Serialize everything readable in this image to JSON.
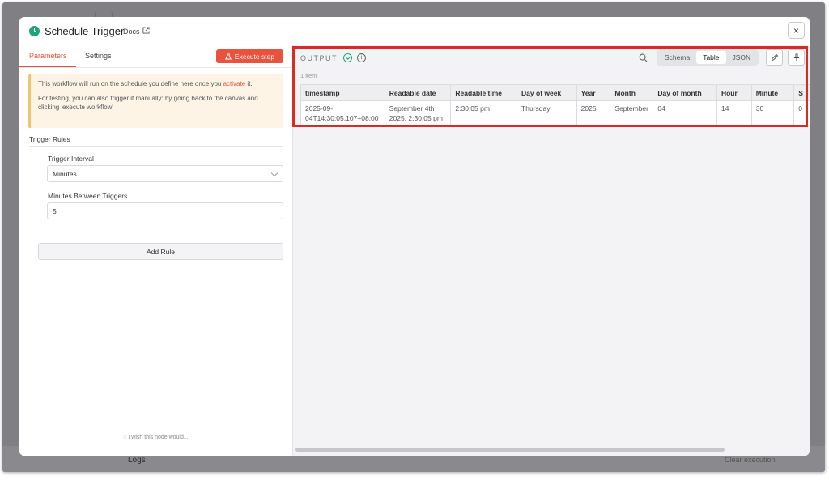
{
  "background": {
    "logs_label": "Logs",
    "clear_execution_label": "Clear execution"
  },
  "modal": {
    "title": "Schedule Trigger",
    "docs_label": "Docs",
    "close_icon": "×"
  },
  "left": {
    "tabs": [
      {
        "label": "Parameters",
        "active": true
      },
      {
        "label": "Settings",
        "active": false
      }
    ],
    "execute_button_label": "Execute step",
    "notice": {
      "line1_before": "This workflow will run on the schedule you define here once you ",
      "line1_link": "activate",
      "line1_after": " it.",
      "line2": "For testing, you can also trigger it manually: by going back to the canvas and clicking 'execute workflow'"
    },
    "section_title": "Trigger Rules",
    "trigger_interval": {
      "label": "Trigger Interval",
      "value": "Minutes"
    },
    "minutes_between": {
      "label": "Minutes Between Triggers",
      "value": "5"
    },
    "add_rule_label": "Add Rule",
    "footer_hint": "I wish this node would..."
  },
  "output": {
    "label": "OUTPUT",
    "info_icon": "i",
    "views": [
      "Schema",
      "Table",
      "JSON"
    ],
    "active_view": "Table",
    "items_count": "1 item",
    "columns": [
      "timestamp",
      "Readable date",
      "Readable time",
      "Day of week",
      "Year",
      "Month",
      "Day of month",
      "Hour",
      "Minute",
      "S"
    ],
    "rows": [
      [
        "2025-09-04T14:30:05.107+08:00",
        "September 4th 2025, 2:30:05 pm",
        "2:30:05 pm",
        "Thursday",
        "2025",
        "September",
        "04",
        "14",
        "30",
        "0"
      ]
    ]
  },
  "colors": {
    "accent": "#e9533d",
    "success": "#20a37a",
    "highlight": "#d92b20"
  }
}
